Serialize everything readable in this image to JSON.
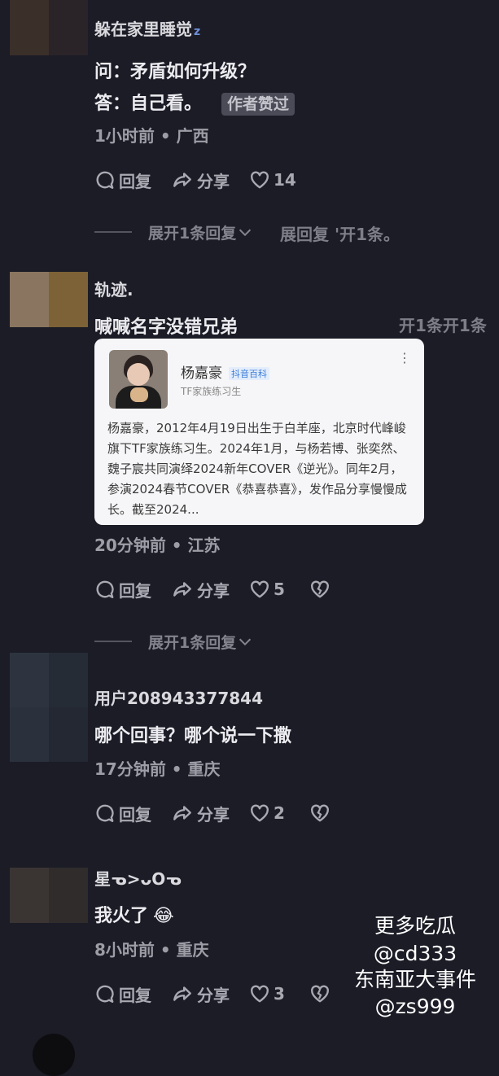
{
  "comments": [
    {
      "username": "躲在家里睡觉",
      "username_suffix": "z",
      "lines": [
        "问：矛盾如何升级？",
        "答：自己看。"
      ],
      "badge": "作者赞过",
      "meta": "1小时前 • 广西",
      "reply_label": "回复",
      "share_label": "分享",
      "like_count": "14",
      "expand_text": "展开1条回复",
      "ghost_overlay": "展回复 '开1条。"
    },
    {
      "username": "轨迹.",
      "lines": [
        "喊喊名字没错兄弟"
      ],
      "ghost_overlay": "开1条开1条",
      "card": {
        "name": "杨嘉豪",
        "tag": "抖音百科",
        "subtitle": "TF家族练习生",
        "more_icon": "⋮",
        "body": "杨嘉豪，2012年4月19日出生于白羊座，北京时代峰峻旗下TF家族练习生。2024年1月，与杨若博、张奕然、魏子宸共同演绎2024新年COVER《逆光》。同年2月，参演2024春节COVER《恭喜恭喜》，发作品分享慢慢成长。截至2024..."
      },
      "meta": "20分钟前 • 江苏",
      "reply_label": "回复",
      "share_label": "分享",
      "like_count": "5",
      "expand_text": "展开1条回复"
    },
    {
      "username": "用户208943377844",
      "lines": [
        "哪个回事？哪个说一下撒"
      ],
      "meta": "17分钟前 • 重庆",
      "reply_label": "回复",
      "share_label": "分享",
      "like_count": "2"
    },
    {
      "username": "星ᓀ>ᴗOᓀ",
      "lines": [
        "我火了"
      ],
      "emoji": "😂",
      "meta": "8小时前 • 重庆",
      "reply_label": "回复",
      "share_label": "分享",
      "like_count": "3"
    }
  ],
  "watermark": [
    "更多吃瓜",
    "@cd333",
    "东南亚大事件",
    "@zs999"
  ],
  "colors": {
    "background": "#1b1c26",
    "text": "#ececf0",
    "muted": "#9d9da6"
  }
}
